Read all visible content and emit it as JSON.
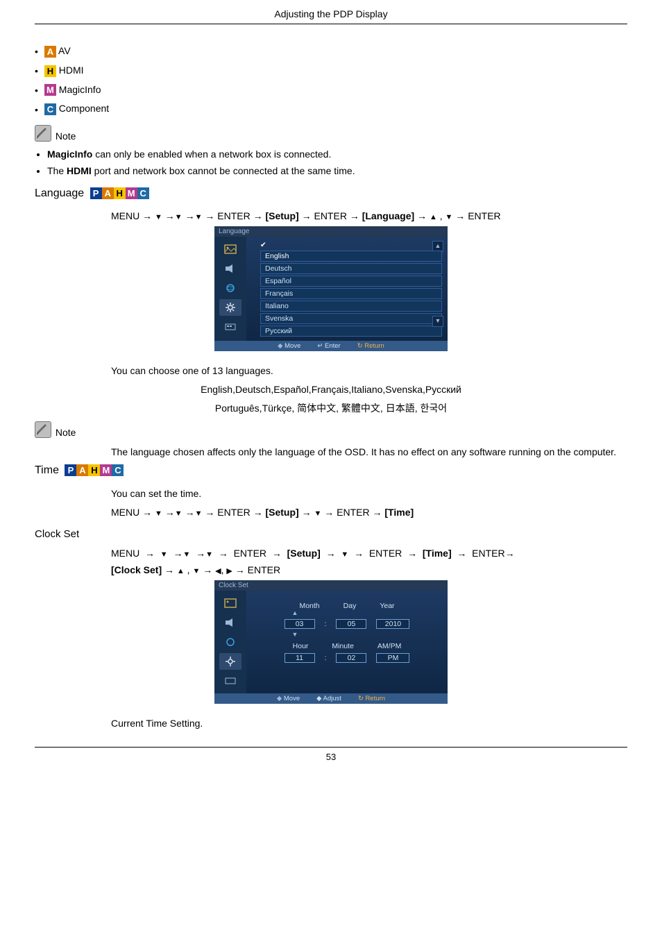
{
  "page": {
    "header": "Adjusting the PDP Display",
    "number": "53"
  },
  "sources": {
    "items": [
      {
        "icon": "A",
        "label": "AV"
      },
      {
        "icon": "H",
        "label": "HDMI"
      },
      {
        "icon": "M",
        "label": "MagicInfo"
      },
      {
        "icon": "C",
        "label": "Component"
      }
    ]
  },
  "note_label": "Note",
  "notes_sources": {
    "lines": [
      {
        "pre": "",
        "bold": "MagicInfo",
        "post": " can only be enabled when a network box is connected."
      },
      {
        "pre": "The ",
        "bold": "HDMI",
        "post": " port and network box cannot be connected at the same time."
      }
    ]
  },
  "language": {
    "heading": "Language",
    "menu_tokens": {
      "menu": "MENU",
      "enter": "ENTER",
      "setup": "[Setup]",
      "language": "[Language]"
    },
    "osd_title": "Language",
    "langs": [
      "English",
      "Deutsch",
      "Español",
      "Français",
      "Italiano",
      "Svenska",
      "Русский"
    ],
    "selected_index": 0,
    "footer": {
      "move": "Move",
      "enter": "Enter",
      "return": "Return"
    },
    "intro": "You can choose one of 13 languages.",
    "lang_line1": "English,Deutsch,Español,Français,Italiano,Svenska,Русский",
    "lang_line2": "Português,Türkçe, 简体中文,  繁體中文, 日本語, 한국어",
    "note_body": "The language chosen affects only the language of the OSD. It has no effect on any software running on the computer."
  },
  "time": {
    "heading": "Time",
    "intro": "You can set the time.",
    "menu": {
      "time": "[Time]"
    }
  },
  "clockset": {
    "heading": "Clock Set",
    "menu": {
      "clockset": "[Clock Set]"
    },
    "osd_title": "Clock Set",
    "labels": {
      "month": "Month",
      "day": "Day",
      "year": "Year",
      "hour": "Hour",
      "minute": "Minute",
      "ampm": "AM/PM"
    },
    "values": {
      "month": "03",
      "day": "05",
      "year": "2010",
      "hour": "11",
      "minute": "02",
      "ampm": "PM"
    },
    "footer": {
      "move": "Move",
      "adjust": "Adjust",
      "return": "Return"
    },
    "body": "Current Time Setting."
  },
  "icons": {
    "P": "P",
    "A": "A",
    "H": "H",
    "M": "M",
    "C": "C"
  }
}
